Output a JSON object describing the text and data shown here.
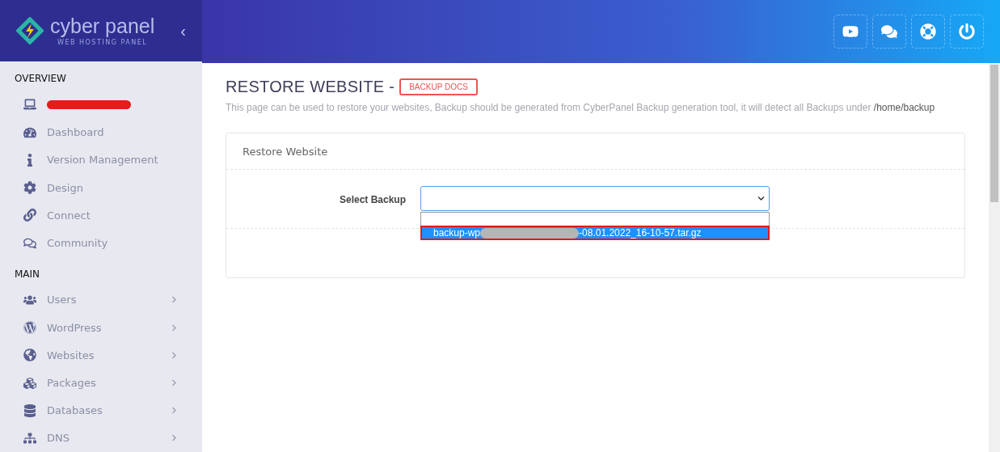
{
  "brand": {
    "name": "cyber panel",
    "tagline": "WEB HOSTING PANEL",
    "collapse": "‹"
  },
  "sidebar": {
    "sections": [
      {
        "title": "OVERVIEW",
        "items": [
          {
            "redacted": true,
            "expandable": false
          },
          {
            "label": "Dashboard",
            "redacted": false,
            "expandable": false
          },
          {
            "label": "Version Management",
            "redacted": false,
            "expandable": false
          },
          {
            "label": "Design",
            "redacted": false,
            "expandable": false
          },
          {
            "label": "Connect",
            "redacted": false,
            "expandable": false
          },
          {
            "label": "Community",
            "redacted": false,
            "expandable": false
          }
        ]
      },
      {
        "title": "MAIN",
        "items": [
          {
            "label": "Users",
            "redacted": false,
            "expandable": true
          },
          {
            "label": "WordPress",
            "redacted": false,
            "expandable": true
          },
          {
            "label": "Websites",
            "redacted": false,
            "expandable": true
          },
          {
            "label": "Packages",
            "redacted": false,
            "expandable": true
          },
          {
            "label": "Databases",
            "redacted": false,
            "expandable": true
          },
          {
            "label": "DNS",
            "redacted": false,
            "expandable": true
          }
        ]
      }
    ]
  },
  "page": {
    "title": "RESTORE WEBSITE -",
    "docs_button": "BACKUP DOCS",
    "description": "This page can be used to restore your websites, Backup should be generated from CyberPanel Backup generation tool, it will detect all Backups under",
    "path": "/home/backup"
  },
  "card": {
    "title": "Restore Website",
    "field_label": "Select Backup",
    "dropdown": {
      "expanded": true,
      "options": [
        {
          "redacted": false,
          "selected": false
        },
        {
          "prefix": "backup-wp",
          "suffix": "-08.01.2022_16-10-57.tar.gz",
          "redacted": true,
          "selected": true
        }
      ]
    }
  }
}
